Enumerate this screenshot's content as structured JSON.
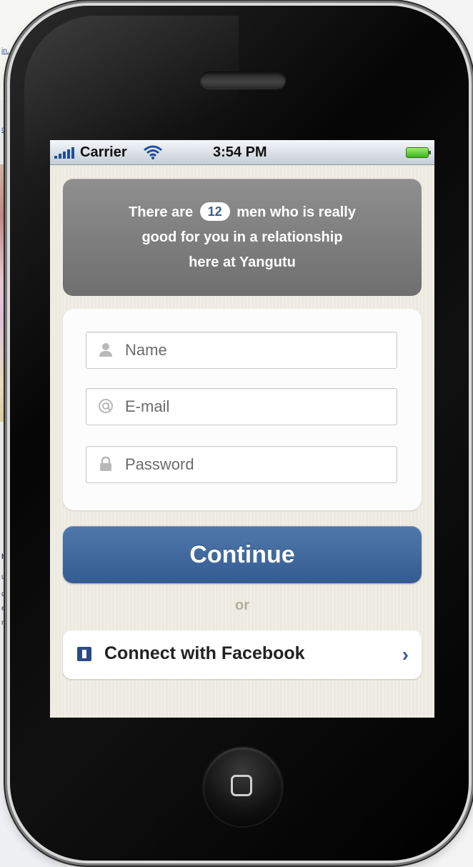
{
  "background_page": {
    "snippets": [
      {
        "text": "in,",
        "link": true
      },
      {
        "text": "ri",
        "link": false
      },
      {
        "text": "or",
        "link": true
      },
      {
        "text": "h",
        "link": false
      },
      {
        "text": "u r",
        "link": false
      },
      {
        "text": "qu",
        "link": false
      },
      {
        "text": "es",
        "link": false
      },
      {
        "text": "nd",
        "link": false
      }
    ]
  },
  "status_bar": {
    "carrier": "Carrier",
    "time": "3:54 PM",
    "signal_icon": "signal-bars-icon",
    "wifi_icon": "wifi-icon",
    "battery_icon": "battery-icon"
  },
  "banner": {
    "text_before": "There are",
    "count": "12",
    "text_after": "men who is really",
    "line2": "good for you in a relationship",
    "line3": "here at Yangutu"
  },
  "form": {
    "name": {
      "value": "",
      "placeholder": "Name",
      "icon": "person-icon"
    },
    "email": {
      "value": "",
      "placeholder": "E-mail",
      "icon": "at-sign-icon"
    },
    "password": {
      "value": "",
      "placeholder": "Password",
      "icon": "lock-icon"
    }
  },
  "continue_label": "Continue",
  "or_label": "or",
  "facebook": {
    "label": "Connect with Facebook",
    "chevron": "›",
    "icon": "facebook-icon"
  },
  "colors": {
    "accent_blue": "#355c92",
    "screen_bg": "#ece9df",
    "banner_gray": "#7a7a7a",
    "facebook_blue": "#2d4a86"
  }
}
